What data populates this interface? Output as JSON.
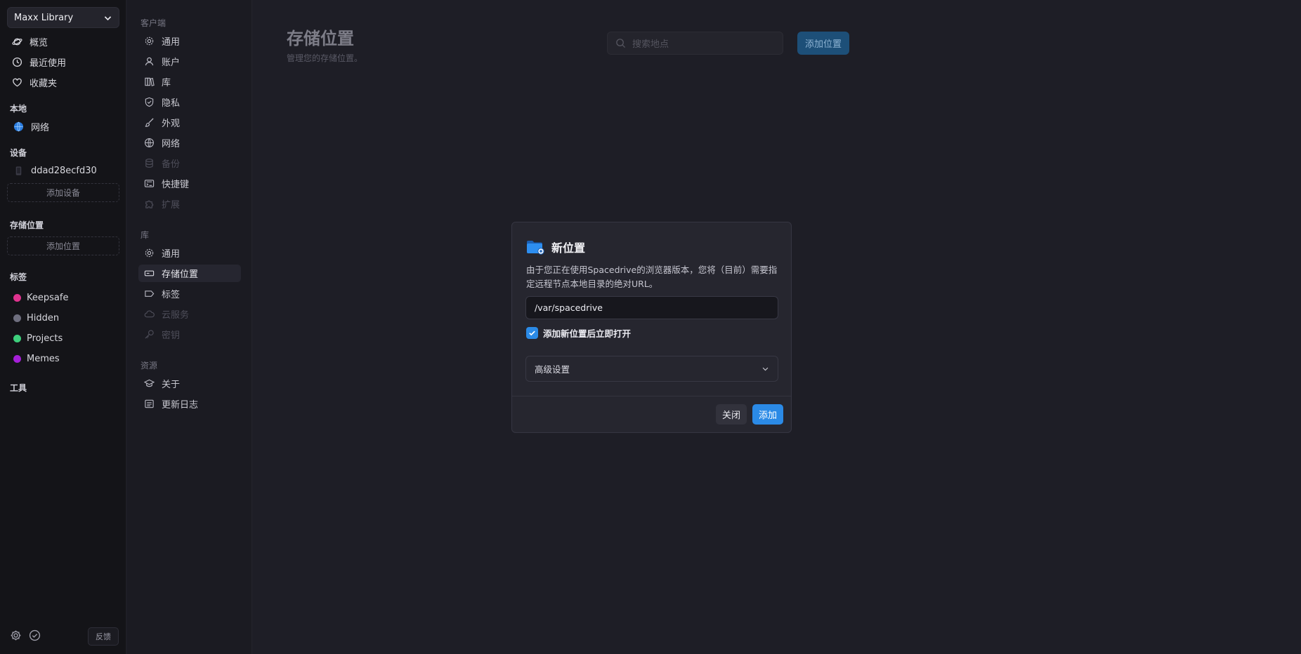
{
  "sidebar": {
    "library_name": "Maxx Library",
    "nav": [
      {
        "label": "概览",
        "icon": "planet-icon"
      },
      {
        "label": "最近使用",
        "icon": "clock-icon"
      },
      {
        "label": "收藏夹",
        "icon": "heart-icon"
      }
    ],
    "local_label": "本地",
    "network_label": "网络",
    "devices_label": "设备",
    "device_name": "ddad28ecfd30",
    "add_device_label": "添加设备",
    "locations_label": "存储位置",
    "add_location_label": "添加位置",
    "tags_label": "标签",
    "tags": [
      {
        "name": "Keepsafe",
        "color": "#e0338f"
      },
      {
        "name": "Hidden",
        "color": "#6e6e7e"
      },
      {
        "name": "Projects",
        "color": "#3ecf7c"
      },
      {
        "name": "Memes",
        "color": "#a51fd8"
      }
    ],
    "tools_label": "工具",
    "feedback_label": "反馈"
  },
  "settings_nav": {
    "client_label": "客户端",
    "client_items": [
      {
        "label": "通用",
        "icon": "gear-icon",
        "disabled": false
      },
      {
        "label": "账户",
        "icon": "user-icon",
        "disabled": false
      },
      {
        "label": "库",
        "icon": "books-icon",
        "disabled": false
      },
      {
        "label": "隐私",
        "icon": "shield-check-icon",
        "disabled": false
      },
      {
        "label": "外观",
        "icon": "paintbrush-icon",
        "disabled": false
      },
      {
        "label": "网络",
        "icon": "globe-icon",
        "disabled": false
      },
      {
        "label": "备份",
        "icon": "database-icon",
        "disabled": true
      },
      {
        "label": "快捷键",
        "icon": "keyboard-icon",
        "disabled": false
      },
      {
        "label": "扩展",
        "icon": "puzzle-icon",
        "disabled": true
      }
    ],
    "library_label": "库",
    "library_items": [
      {
        "label": "通用",
        "icon": "gear-icon",
        "disabled": false,
        "active": false
      },
      {
        "label": "存储位置",
        "icon": "drive-icon",
        "disabled": false,
        "active": true
      },
      {
        "label": "标签",
        "icon": "tag-icon",
        "disabled": false,
        "active": false
      },
      {
        "label": "云服务",
        "icon": "cloud-icon",
        "disabled": true,
        "active": false
      },
      {
        "label": "密钥",
        "icon": "key-icon",
        "disabled": true,
        "active": false
      }
    ],
    "resources_label": "资源",
    "resources_items": [
      {
        "label": "关于",
        "icon": "mortarboard-icon"
      },
      {
        "label": "更新日志",
        "icon": "notepad-icon"
      }
    ]
  },
  "main": {
    "title": "存储位置",
    "subtitle": "管理您的存储位置。",
    "search_placeholder": "搜索地点",
    "add_button": "添加位置"
  },
  "modal": {
    "title": "新位置",
    "description": "由于您正在使用Spacedrive的浏览器版本，您将（目前）需要指定远程节点本地目录的绝对URL。",
    "path_value": "/var/spacedrive",
    "checkbox_label": "添加新位置后立即打开",
    "checkbox_checked": true,
    "advanced_label": "高级设置",
    "close_button": "关闭",
    "add_button": "添加"
  }
}
